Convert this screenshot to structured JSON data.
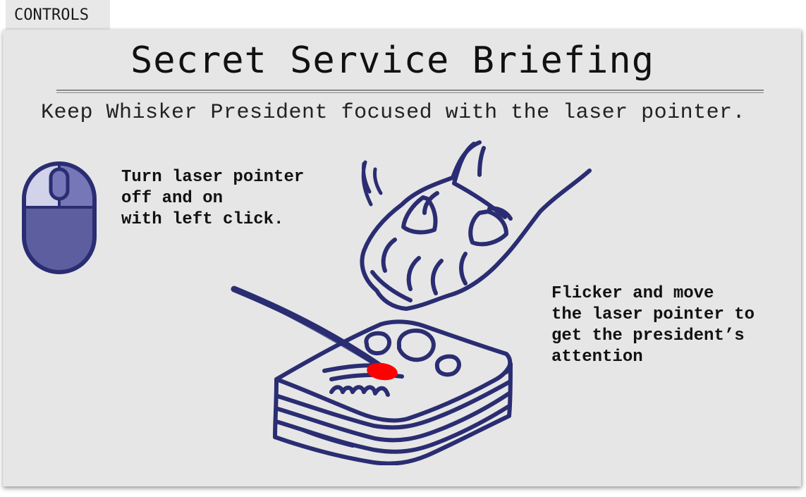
{
  "tab": {
    "label": "CONTROLS"
  },
  "briefing": {
    "title": "Secret Service Briefing",
    "subtitle": "Keep Whisker President focused with the laser pointer."
  },
  "instructions": {
    "click": "Turn laser pointer\noff and on\nwith left click.",
    "move": "Flicker and move\nthe laser pointer to\nget the president’s\nattention"
  },
  "icons": {
    "mouse": "mouse-left-click-icon",
    "illustration": "paw-and-book-laser-illustration"
  },
  "colors": {
    "ink": "#2a2d72",
    "mouse_fill": "#5c5ea0",
    "mouse_highlight": "#7677b8",
    "laser": "#ff0000",
    "panel": "#e6e6e6"
  }
}
